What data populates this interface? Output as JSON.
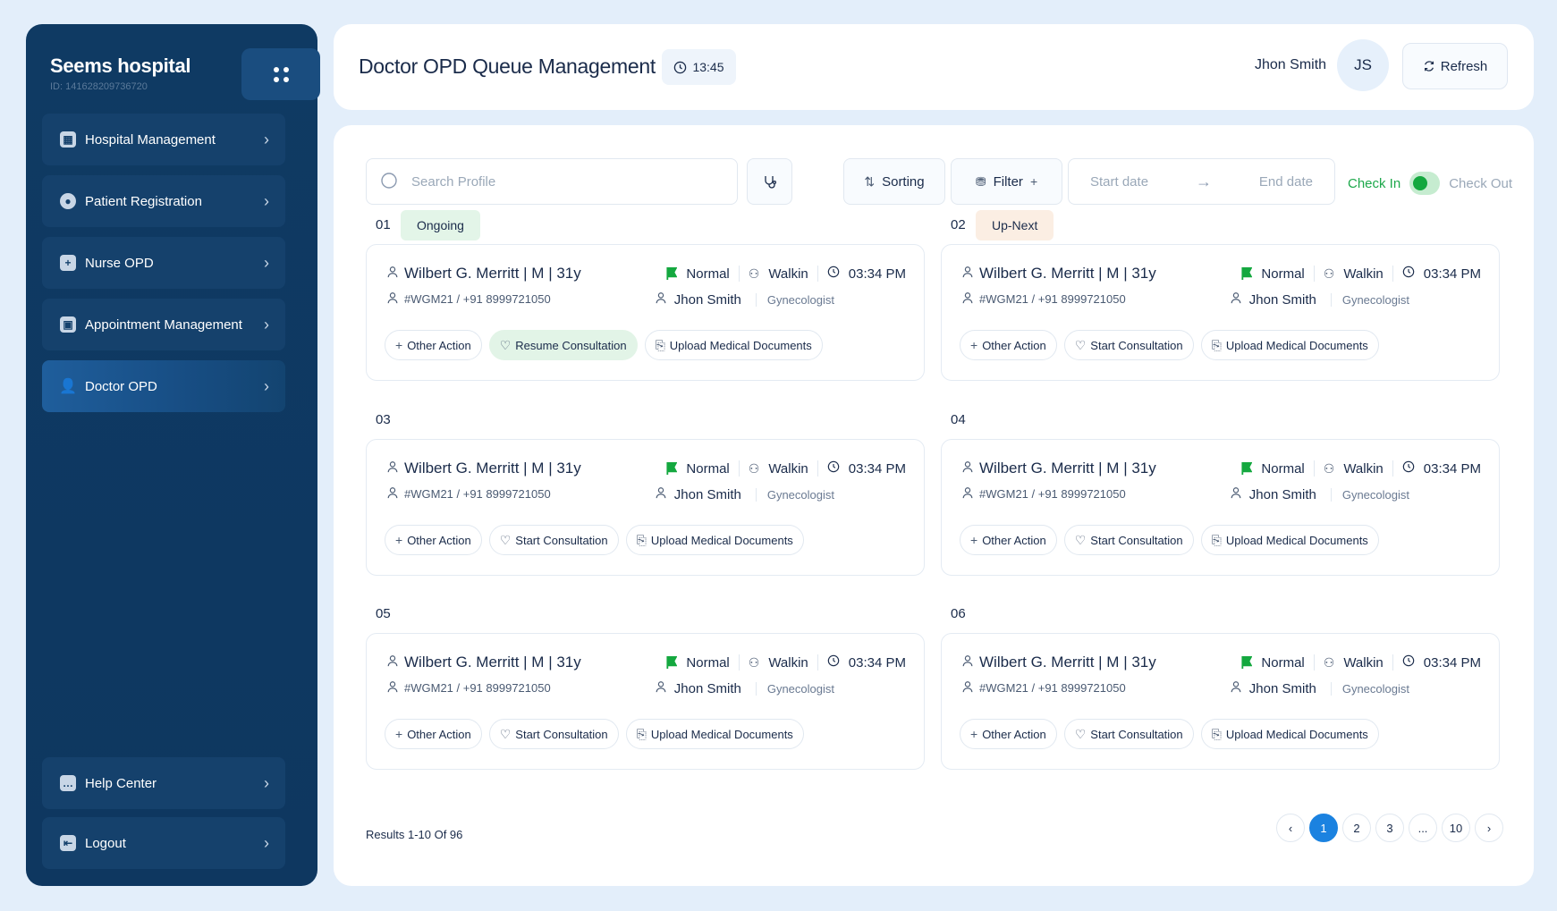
{
  "sidebar": {
    "hospital_name": "Seems hospital",
    "hospital_id": "ID: 141628209736720",
    "items": [
      {
        "label": "Hospital Management",
        "icon": "building-icon"
      },
      {
        "label": "Patient Registration",
        "icon": "user-circle-icon"
      },
      {
        "label": "Nurse OPD",
        "icon": "plus-square-icon"
      },
      {
        "label": "Appointment Management",
        "icon": "calendar-user-icon"
      },
      {
        "label": "Doctor OPD",
        "icon": "doctor-icon"
      }
    ],
    "bottom_items": [
      {
        "label": "Help Center",
        "icon": "chat-icon"
      },
      {
        "label": "Logout",
        "icon": "logout-icon"
      }
    ]
  },
  "header": {
    "title": "Doctor OPD Queue Management",
    "time": "13:45",
    "user_name": "Jhon Smith",
    "user_initials": "JS",
    "refresh_label": "Refresh"
  },
  "toolbar": {
    "search_placeholder": "Search Profile",
    "sorting_label": "Sorting",
    "filter_label": "Filter",
    "start_date_placeholder": "Start date",
    "end_date_placeholder": "End date",
    "check_in_label": "Check In",
    "check_out_label": "Check Out"
  },
  "queue": [
    {
      "num": "01",
      "status": "Ongoing",
      "patient": "Wilbert G. Merritt | M | 31y",
      "id": "#WGM21 / +91 8999721050",
      "priority": "Normal",
      "mode": "Walkin",
      "time": "03:34 PM",
      "doctor": "Jhon Smith",
      "specialty": "Gynecologist",
      "actions": [
        "Other Action",
        "Resume Consultation",
        "Upload Medical Documents"
      ]
    },
    {
      "num": "02",
      "status": "Up-Next",
      "patient": "Wilbert G. Merritt | M | 31y",
      "id": "#WGM21 / +91 8999721050",
      "priority": "Normal",
      "mode": "Walkin",
      "time": "03:34 PM",
      "doctor": "Jhon Smith",
      "specialty": "Gynecologist",
      "actions": [
        "Other Action",
        "Start Consultation",
        "Upload Medical Documents"
      ]
    },
    {
      "num": "03",
      "status": "",
      "patient": "Wilbert G. Merritt | M | 31y",
      "id": "#WGM21 / +91 8999721050",
      "priority": "Normal",
      "mode": "Walkin",
      "time": "03:34 PM",
      "doctor": "Jhon Smith",
      "specialty": "Gynecologist",
      "actions": [
        "Other Action",
        "Start Consultation",
        "Upload Medical Documents"
      ]
    },
    {
      "num": "04",
      "status": "",
      "patient": "Wilbert G. Merritt | M | 31y",
      "id": "#WGM21 / +91 8999721050",
      "priority": "Normal",
      "mode": "Walkin",
      "time": "03:34 PM",
      "doctor": "Jhon Smith",
      "specialty": "Gynecologist",
      "actions": [
        "Other Action",
        "Start Consultation",
        "Upload Medical Documents"
      ]
    },
    {
      "num": "05",
      "status": "",
      "patient": "Wilbert G. Merritt | M | 31y",
      "id": "#WGM21 / +91 8999721050",
      "priority": "Normal",
      "mode": "Walkin",
      "time": "03:34 PM",
      "doctor": "Jhon Smith",
      "specialty": "Gynecologist",
      "actions": [
        "Other Action",
        "Start Consultation",
        "Upload Medical Documents"
      ]
    },
    {
      "num": "06",
      "status": "",
      "patient": "Wilbert G. Merritt | M | 31y",
      "id": "#WGM21 / +91 8999721050",
      "priority": "Normal",
      "mode": "Walkin",
      "time": "03:34 PM",
      "doctor": "Jhon Smith",
      "specialty": "Gynecologist",
      "actions": [
        "Other Action",
        "Start Consultation",
        "Upload Medical Documents"
      ]
    }
  ],
  "footer": {
    "results_text": "Results 1-10 Of 96",
    "pages": [
      "1",
      "2",
      "3",
      "...",
      "10"
    ],
    "current_page": "1"
  },
  "colors": {
    "sidebar_bg": "#0f3a63",
    "accent": "#1b82e0",
    "success": "#14a83f"
  }
}
